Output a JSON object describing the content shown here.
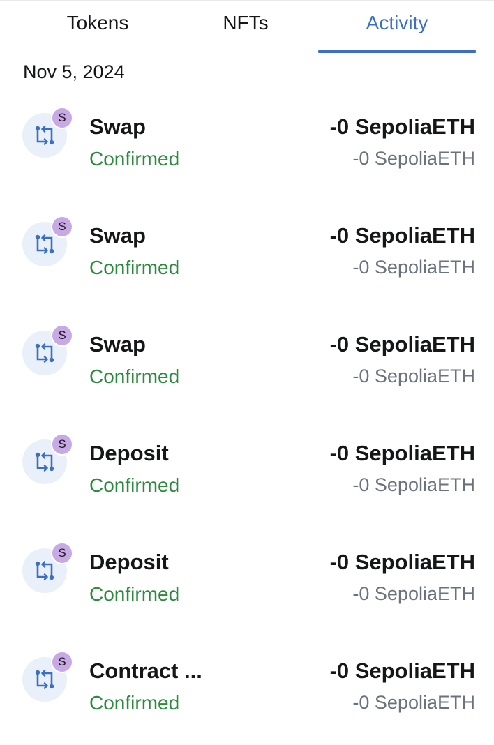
{
  "tabs": [
    {
      "label": "Tokens",
      "active": false
    },
    {
      "label": "NFTs",
      "active": false
    },
    {
      "label": "Activity",
      "active": true
    }
  ],
  "colors": {
    "accent": "#3b6fc4",
    "confirmed": "#2b8a3e",
    "badge": "#c7a9e3",
    "muted": "#6a737d"
  },
  "activity": {
    "date": "Nov 5, 2024",
    "transactions": [
      {
        "icon": "swap-arrows-icon",
        "network_badge": "S",
        "title": "Swap",
        "status": "Confirmed",
        "primary_amount": "-0 SepoliaETH",
        "secondary_amount": "-0 SepoliaETH"
      },
      {
        "icon": "swap-arrows-icon",
        "network_badge": "S",
        "title": "Swap",
        "status": "Confirmed",
        "primary_amount": "-0 SepoliaETH",
        "secondary_amount": "-0 SepoliaETH"
      },
      {
        "icon": "swap-arrows-icon",
        "network_badge": "S",
        "title": "Swap",
        "status": "Confirmed",
        "primary_amount": "-0 SepoliaETH",
        "secondary_amount": "-0 SepoliaETH"
      },
      {
        "icon": "swap-arrows-icon",
        "network_badge": "S",
        "title": "Deposit",
        "status": "Confirmed",
        "primary_amount": "-0 SepoliaETH",
        "secondary_amount": "-0 SepoliaETH"
      },
      {
        "icon": "swap-arrows-icon",
        "network_badge": "S",
        "title": "Deposit",
        "status": "Confirmed",
        "primary_amount": "-0 SepoliaETH",
        "secondary_amount": "-0 SepoliaETH"
      },
      {
        "icon": "swap-arrows-icon",
        "network_badge": "S",
        "title": "Contract ...",
        "status": "Confirmed",
        "primary_amount": "-0 SepoliaETH",
        "secondary_amount": "-0 SepoliaETH"
      }
    ]
  }
}
